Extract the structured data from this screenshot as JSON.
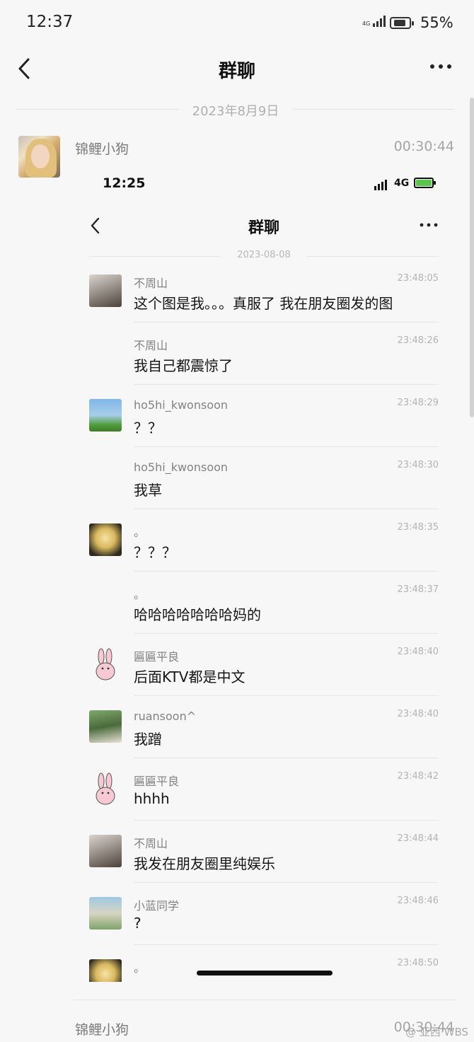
{
  "status_bar": {
    "time": "12:37",
    "network": "4G",
    "battery": "55%"
  },
  "header": {
    "title": "群聊"
  },
  "date_separator": "2023年8月9日",
  "message": {
    "sender": "锦鲤小狗",
    "time": "00:30:44"
  },
  "embedded": {
    "status": {
      "time": "12:25",
      "network": "4G"
    },
    "title": "群聊",
    "date": "2023-08-08",
    "messages": [
      {
        "name": "不周山",
        "time": "23:48:05",
        "text": "这个图是我。。。真服了 我在朋友圈发的图",
        "avatar": "avatar-photo"
      },
      {
        "name": "不周山",
        "time": "23:48:26",
        "text": "我自己都震惊了",
        "avatar": ""
      },
      {
        "name": "ho5hi_kwonsoon",
        "time": "23:48:29",
        "text": "？？",
        "avatar": "avatar-photo"
      },
      {
        "name": "ho5hi_kwonsoon",
        "time": "23:48:30",
        "text": "我草",
        "avatar": ""
      },
      {
        "name": "。",
        "time": "23:48:35",
        "text": "？？？",
        "avatar": "avatar-photo"
      },
      {
        "name": "。",
        "time": "23:48:37",
        "text": "哈哈哈哈哈哈哈妈的",
        "avatar": ""
      },
      {
        "name": "匾匾平良",
        "time": "23:48:40",
        "text": "后面KTV都是中文",
        "avatar": "rabbit-icon"
      },
      {
        "name": "ruansoon^",
        "time": "23:48:40",
        "text": "我蹭",
        "avatar": "avatar-photo"
      },
      {
        "name": "匾匾平良",
        "time": "23:48:42",
        "text": "hhhh",
        "avatar": "rabbit-icon"
      },
      {
        "name": "不周山",
        "time": "23:48:44",
        "text": "我发在朋友圈里纯娱乐",
        "avatar": "avatar-photo"
      },
      {
        "name": "小蓝同学",
        "time": "23:48:46",
        "text": "?",
        "avatar": "avatar-photo"
      },
      {
        "name": "。",
        "time": "23:48:50",
        "text": "",
        "avatar": "avatar-photo"
      }
    ]
  },
  "next_message": {
    "sender": "锦鲤小狗",
    "time": "00:30:44"
  },
  "watermark": "@ 亚西·WBS"
}
